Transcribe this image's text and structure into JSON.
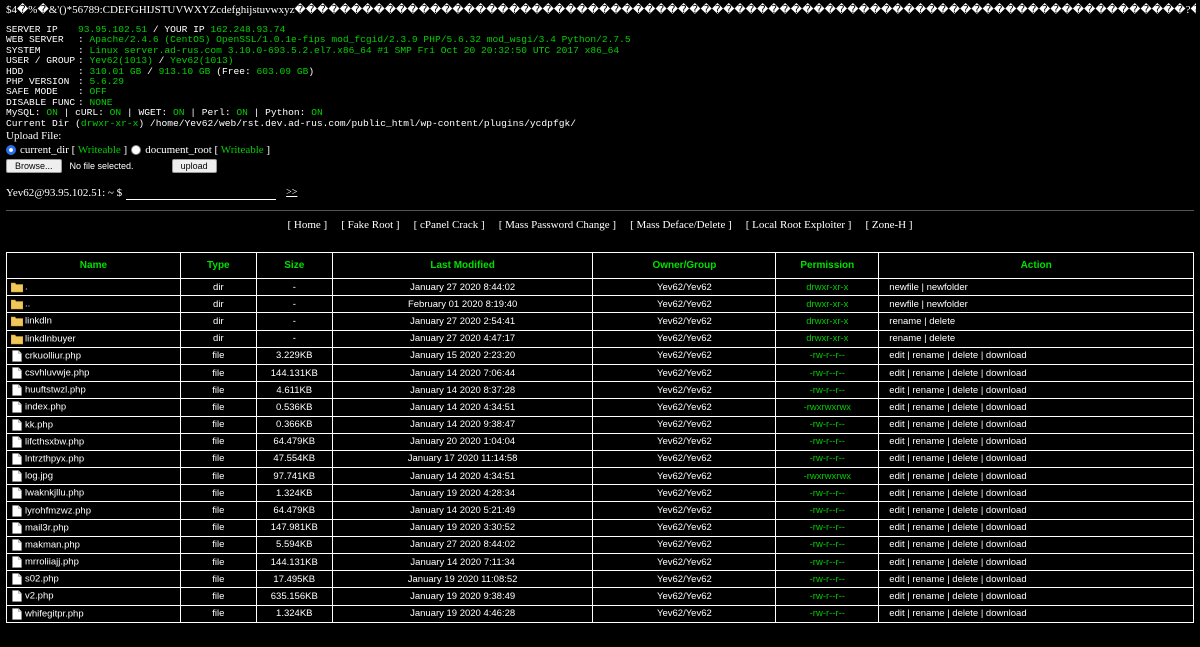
{
  "top_text": "$4�%�&'()*56789:CDEFGHIJSTUVWXYZcdefghijstuvwxyz�������������������������������������������������������������������������������?��(��9(���(���",
  "info": [
    {
      "key": "SERVER IP",
      "parts": [
        {
          "t": "93.95.102.51",
          "g": true
        },
        {
          "t": " / YOUR IP ",
          "g": false
        },
        {
          "t": "162.248.93.74",
          "g": true
        }
      ]
    },
    {
      "key": "WEB SERVER",
      "parts": [
        {
          "t": ": ",
          "g": false
        },
        {
          "t": "Apache/2.4.6 (CentOS) OpenSSL/1.0.1e-fips mod_fcgid/2.3.9 PHP/5.6.32 mod_wsgi/3.4 Python/2.7.5",
          "g": true
        }
      ]
    },
    {
      "key": "SYSTEM",
      "parts": [
        {
          "t": ": ",
          "g": false
        },
        {
          "t": "Linux server.ad-rus.com 3.10.0-693.5.2.el7.x86_64 #1 SMP Fri Oct 20 20:32:50 UTC 2017 x86_64",
          "g": true
        }
      ]
    },
    {
      "key": "USER / GROUP",
      "parts": [
        {
          "t": ": ",
          "g": false
        },
        {
          "t": "Yev62(1013)",
          "g": true
        },
        {
          "t": " / ",
          "g": false
        },
        {
          "t": "Yev62(1013)",
          "g": true
        }
      ]
    },
    {
      "key": "HDD",
      "parts": [
        {
          "t": ": ",
          "g": false
        },
        {
          "t": "310.01 GB",
          "g": true
        },
        {
          "t": " / ",
          "g": false
        },
        {
          "t": "913.10 GB",
          "g": true
        },
        {
          "t": " (Free: ",
          "g": false
        },
        {
          "t": "603.09 GB",
          "g": true
        },
        {
          "t": ")",
          "g": false
        }
      ]
    },
    {
      "key": "PHP VERSION",
      "parts": [
        {
          "t": ": ",
          "g": false
        },
        {
          "t": "5.6.29",
          "g": true
        }
      ]
    },
    {
      "key": "SAFE MODE",
      "parts": [
        {
          "t": ": ",
          "g": false
        },
        {
          "t": "OFF",
          "g": true
        }
      ]
    },
    {
      "key": "DISABLE FUNC",
      "parts": [
        {
          "t": ": ",
          "g": false
        },
        {
          "t": "NONE",
          "g": true
        }
      ]
    }
  ],
  "modules": [
    {
      "t": "MySQL: ",
      "g": false
    },
    {
      "t": "ON",
      "g": true
    },
    {
      "t": " | cURL: ",
      "g": false
    },
    {
      "t": "ON",
      "g": true
    },
    {
      "t": " | WGET: ",
      "g": false
    },
    {
      "t": "ON",
      "g": true
    },
    {
      "t": " | Perl: ",
      "g": false
    },
    {
      "t": "ON",
      "g": true
    },
    {
      "t": " | Python: ",
      "g": false
    },
    {
      "t": "ON",
      "g": true
    }
  ],
  "current_dir": {
    "label": "Current Dir (",
    "perm": "drwxr-xr-x",
    "path": ") /home/Yev62/web/rst.dev.ad-rus.com/public_html/wp-content/plugins/ycdpfgk/"
  },
  "upload": {
    "label": "Upload File:",
    "opt1": "current_dir [ ",
    "opt1_w": "Writeable",
    "opt1_end": " ]",
    "opt2": "document_root [ ",
    "opt2_w": "Writeable",
    "opt2_end": " ]",
    "browse": "Browse...",
    "no_file": "No file selected.",
    "upload_btn": "upload"
  },
  "prompt": {
    "label": "Yev62@93.95.102.51: ~ $",
    "go": ">>"
  },
  "menu": [
    "[ Home ]",
    "[ Fake Root ]",
    "[ cPanel Crack ]",
    "[ Mass Password Change ]",
    "[ Mass Deface/Delete ]",
    "[ Local Root Exploiter ]",
    "[ Zone-H ]"
  ],
  "columns": [
    "Name",
    "Type",
    "Size",
    "Last Modified",
    "Owner/Group",
    "Permission",
    "Action"
  ],
  "rows": [
    {
      "icon": "folder",
      "name": ".",
      "type": "dir",
      "size": "-",
      "mod": "January 27 2020 8:44:02",
      "owner": "Yev62/Yev62",
      "perm": "drwxr-xr-x",
      "action": "newfile | newfolder"
    },
    {
      "icon": "folder",
      "name": "..",
      "type": "dir",
      "size": "-",
      "mod": "February 01 2020 8:19:40",
      "owner": "Yev62/Yev62",
      "perm": "drwxr-xr-x",
      "action": "newfile | newfolder"
    },
    {
      "icon": "folder",
      "name": "linkdln",
      "type": "dir",
      "size": "-",
      "mod": "January 27 2020 2:54:41",
      "owner": "Yev62/Yev62",
      "perm": "drwxr-xr-x",
      "action": "rename | delete"
    },
    {
      "icon": "folder",
      "name": "linkdlnbuyer",
      "type": "dir",
      "size": "-",
      "mod": "January 27 2020 4:47:17",
      "owner": "Yev62/Yev62",
      "perm": "drwxr-xr-x",
      "action": "rename | delete"
    },
    {
      "icon": "file",
      "name": "crkuolliur.php",
      "type": "file",
      "size": "3.229KB",
      "mod": "January 15 2020 2:23:20",
      "owner": "Yev62/Yev62",
      "perm": "-rw-r--r--",
      "action": "edit | rename | delete | download"
    },
    {
      "icon": "file",
      "name": "csvhluvwje.php",
      "type": "file",
      "size": "144.131KB",
      "mod": "January 14 2020 7:06:44",
      "owner": "Yev62/Yev62",
      "perm": "-rw-r--r--",
      "action": "edit | rename | delete | download"
    },
    {
      "icon": "file",
      "name": "huuftstwzl.php",
      "type": "file",
      "size": "4.611KB",
      "mod": "January 14 2020 8:37:28",
      "owner": "Yev62/Yev62",
      "perm": "-rw-r--r--",
      "action": "edit | rename | delete | download"
    },
    {
      "icon": "file",
      "name": "index.php",
      "type": "file",
      "size": "0.536KB",
      "mod": "January 14 2020 4:34:51",
      "owner": "Yev62/Yev62",
      "perm": "-rwxrwxrwx",
      "action": "edit | rename | delete | download"
    },
    {
      "icon": "file",
      "name": "kk.php",
      "type": "file",
      "size": "0.366KB",
      "mod": "January 14 2020 9:38:47",
      "owner": "Yev62/Yev62",
      "perm": "-rw-r--r--",
      "action": "edit | rename | delete | download"
    },
    {
      "icon": "file",
      "name": "lifcthsxbw.php",
      "type": "file",
      "size": "64.479KB",
      "mod": "January 20 2020 1:04:04",
      "owner": "Yev62/Yev62",
      "perm": "-rw-r--r--",
      "action": "edit | rename | delete | download"
    },
    {
      "icon": "file",
      "name": "lntrzthpyx.php",
      "type": "file",
      "size": "47.554KB",
      "mod": "January 17 2020 11:14:58",
      "owner": "Yev62/Yev62",
      "perm": "-rw-r--r--",
      "action": "edit | rename | delete | download"
    },
    {
      "icon": "file",
      "name": "log.jpg",
      "type": "file",
      "size": "97.741KB",
      "mod": "January 14 2020 4:34:51",
      "owner": "Yev62/Yev62",
      "perm": "-rwxrwxrwx",
      "action": "edit | rename | delete | download"
    },
    {
      "icon": "file",
      "name": "lwaknkjllu.php",
      "type": "file",
      "size": "1.324KB",
      "mod": "January 19 2020 4:28:34",
      "owner": "Yev62/Yev62",
      "perm": "-rw-r--r--",
      "action": "edit | rename | delete | download"
    },
    {
      "icon": "file",
      "name": "lyrohfmzwz.php",
      "type": "file",
      "size": "64.479KB",
      "mod": "January 14 2020 5:21:49",
      "owner": "Yev62/Yev62",
      "perm": "-rw-r--r--",
      "action": "edit | rename | delete | download"
    },
    {
      "icon": "file",
      "name": "mail3r.php",
      "type": "file",
      "size": "147.981KB",
      "mod": "January 19 2020 3:30:52",
      "owner": "Yev62/Yev62",
      "perm": "-rw-r--r--",
      "action": "edit | rename | delete | download"
    },
    {
      "icon": "file",
      "name": "makman.php",
      "type": "file",
      "size": "5.594KB",
      "mod": "January 27 2020 8:44:02",
      "owner": "Yev62/Yev62",
      "perm": "-rw-r--r--",
      "action": "edit | rename | delete | download"
    },
    {
      "icon": "file",
      "name": "mrroliiajj.php",
      "type": "file",
      "size": "144.131KB",
      "mod": "January 14 2020 7:11:34",
      "owner": "Yev62/Yev62",
      "perm": "-rw-r--r--",
      "action": "edit | rename | delete | download"
    },
    {
      "icon": "file",
      "name": "s02.php",
      "type": "file",
      "size": "17.495KB",
      "mod": "January 19 2020 11:08:52",
      "owner": "Yev62/Yev62",
      "perm": "-rw-r--r--",
      "action": "edit | rename | delete | download"
    },
    {
      "icon": "file",
      "name": "v2.php",
      "type": "file",
      "size": "635.156KB",
      "mod": "January 19 2020 9:38:49",
      "owner": "Yev62/Yev62",
      "perm": "-rw-r--r--",
      "action": "edit | rename | delete | download"
    },
    {
      "icon": "file",
      "name": "whifegitpr.php",
      "type": "file",
      "size": "1.324KB",
      "mod": "January 19 2020 4:46:28",
      "owner": "Yev62/Yev62",
      "perm": "-rw-r--r--",
      "action": "edit | rename | delete | download"
    }
  ]
}
